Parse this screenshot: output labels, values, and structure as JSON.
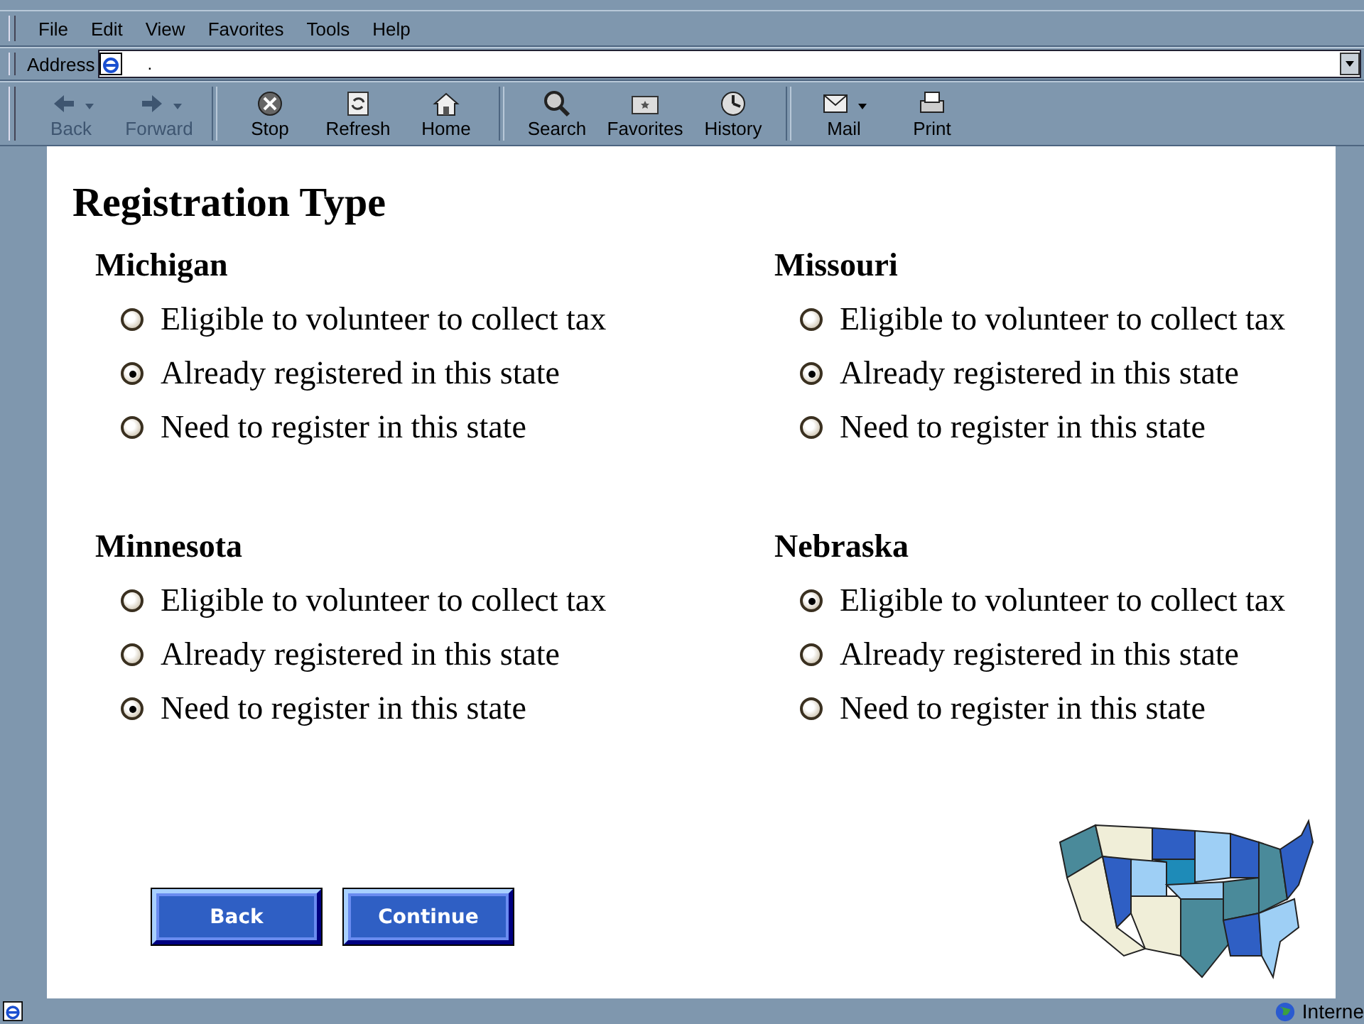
{
  "menu": [
    "File",
    "Edit",
    "View",
    "Favorites",
    "Tools",
    "Help"
  ],
  "address": {
    "label": "Address",
    "value": "."
  },
  "toolbar": [
    {
      "label": "Back",
      "kind": "back",
      "disabled": true,
      "dropdown": true
    },
    {
      "label": "Forward",
      "kind": "forward",
      "disabled": true,
      "dropdown": true
    },
    {
      "label": "Stop",
      "kind": "stop",
      "disabled": false,
      "dropdown": false
    },
    {
      "label": "Refresh",
      "kind": "refresh",
      "disabled": false,
      "dropdown": false
    },
    {
      "label": "Home",
      "kind": "home",
      "disabled": false,
      "dropdown": false
    },
    {
      "label": "Search",
      "kind": "search",
      "disabled": false,
      "dropdown": false
    },
    {
      "label": "Favorites",
      "kind": "favorites",
      "disabled": false,
      "dropdown": false
    },
    {
      "label": "History",
      "kind": "history",
      "disabled": false,
      "dropdown": false
    },
    {
      "label": "Mail",
      "kind": "mail",
      "disabled": false,
      "dropdown": true
    },
    {
      "label": "Print",
      "kind": "print",
      "disabled": false,
      "dropdown": false
    }
  ],
  "page": {
    "title": "Registration Type",
    "states": [
      {
        "name": "Michigan",
        "options": [
          {
            "label": "Eligible to volunteer to collect tax",
            "selected": false
          },
          {
            "label": "Already registered in this state",
            "selected": true
          },
          {
            "label": "Need to register in this state",
            "selected": false
          }
        ]
      },
      {
        "name": "Missouri",
        "options": [
          {
            "label": "Eligible to volunteer to collect tax",
            "selected": false
          },
          {
            "label": "Already registered in this state",
            "selected": true
          },
          {
            "label": "Need to register in this state",
            "selected": false
          }
        ]
      },
      {
        "name": "Minnesota",
        "options": [
          {
            "label": "Eligible to volunteer to collect tax",
            "selected": false
          },
          {
            "label": "Already registered in this state",
            "selected": false
          },
          {
            "label": "Need to register in this state",
            "selected": true
          }
        ]
      },
      {
        "name": "Nebraska",
        "options": [
          {
            "label": "Eligible to volunteer to collect tax",
            "selected": true
          },
          {
            "label": "Already registered in this state",
            "selected": false
          },
          {
            "label": "Need to register in this state",
            "selected": false
          }
        ]
      }
    ],
    "buttons": [
      "Back",
      "Continue"
    ]
  },
  "status_bar": {
    "zone": "Interne"
  }
}
